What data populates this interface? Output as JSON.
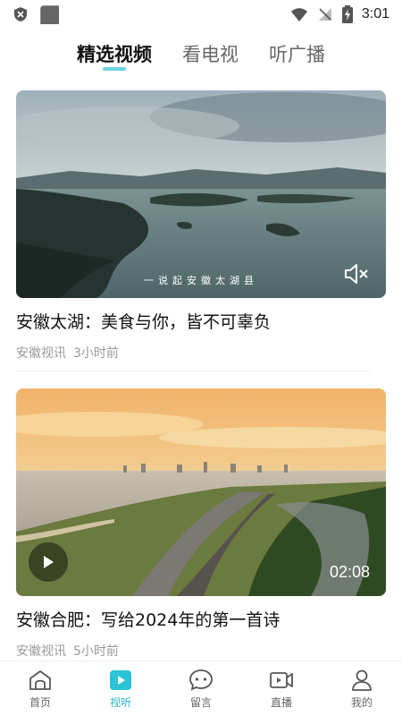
{
  "status_bar": {
    "time": "3:01",
    "icons": [
      "shield-icon",
      "app-square-icon",
      "wifi-icon",
      "signal-off-icon",
      "battery-charging-icon"
    ]
  },
  "top_tabs": [
    {
      "label": "精选视频",
      "active": true
    },
    {
      "label": "看电视",
      "active": false
    },
    {
      "label": "听广播",
      "active": false
    }
  ],
  "videos": [
    {
      "overlay_caption": "一说起安徽太湖县",
      "title": "安徽太湖：美食与你，皆不可辜负",
      "source": "安徽视讯",
      "time_ago": "3小时前",
      "muted": true
    },
    {
      "duration": "02:08",
      "title": "安徽合肥：写给2024年的第一首诗",
      "source": "安徽视讯",
      "time_ago": "5小时前"
    }
  ],
  "bottom_nav": [
    {
      "label": "首页",
      "icon": "home-icon",
      "active": false
    },
    {
      "label": "视听",
      "icon": "play-icon",
      "active": true
    },
    {
      "label": "留言",
      "icon": "chat-icon",
      "active": false
    },
    {
      "label": "直播",
      "icon": "video-camera-icon",
      "active": false
    },
    {
      "label": "我的",
      "icon": "user-icon",
      "active": false
    }
  ],
  "colors": {
    "accent": "#2bb3c6"
  }
}
